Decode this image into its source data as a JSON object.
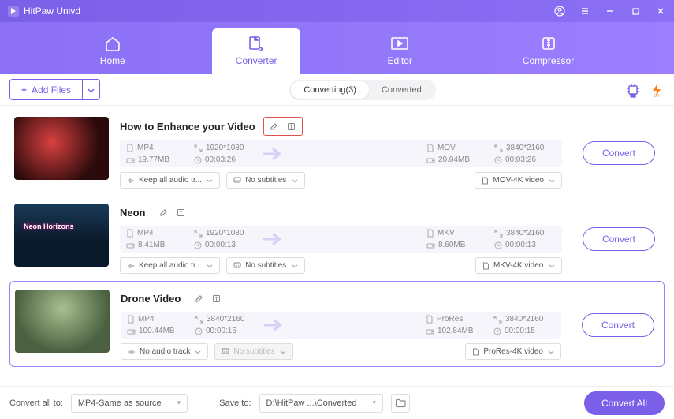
{
  "app": {
    "name": "HitPaw Univd"
  },
  "tabs": {
    "home": "Home",
    "converter": "Converter",
    "editor": "Editor",
    "compressor": "Compressor"
  },
  "toolbar": {
    "addFiles": "Add Files",
    "segments": {
      "converting": "Converting(3)",
      "converted": "Converted"
    }
  },
  "items": [
    {
      "title": "How to Enhance your Video",
      "src": {
        "format": "MP4",
        "res": "1920*1080",
        "size": "19.77MB",
        "dur": "00:03:26"
      },
      "dst": {
        "format": "MOV",
        "res": "3840*2160",
        "size": "20.04MB",
        "dur": "00:03:26"
      },
      "audio": "Keep all audio tr...",
      "subs": "No subtitles",
      "preset": "MOV-4K video",
      "btn": "Convert",
      "subsDisabled": false,
      "highlightEdit": true
    },
    {
      "title": "Neon",
      "src": {
        "format": "MP4",
        "res": "1920*1080",
        "size": "8.41MB",
        "dur": "00:00:13"
      },
      "dst": {
        "format": "MKV",
        "res": "3840*2160",
        "size": "8.60MB",
        "dur": "00:00:13"
      },
      "audio": "Keep all audio tr...",
      "subs": "No subtitles",
      "preset": "MKV-4K video",
      "btn": "Convert",
      "subsDisabled": false,
      "highlightEdit": false
    },
    {
      "title": "Drone Video",
      "src": {
        "format": "MP4",
        "res": "3840*2160",
        "size": "100.44MB",
        "dur": "00:00:15"
      },
      "dst": {
        "format": "ProRes",
        "res": "3840*2160",
        "size": "102.84MB",
        "dur": "00:00:15"
      },
      "audio": "No audio track",
      "subs": "No subtitles",
      "preset": "ProRes-4K video",
      "btn": "Convert",
      "subsDisabled": true,
      "highlightEdit": false
    }
  ],
  "footer": {
    "convertAllLabel": "Convert all to:",
    "convertAllValue": "MP4-Same as source",
    "saveToLabel": "Save to:",
    "saveToValue": "D:\\HitPaw ...\\Converted",
    "convertAll": "Convert All"
  }
}
